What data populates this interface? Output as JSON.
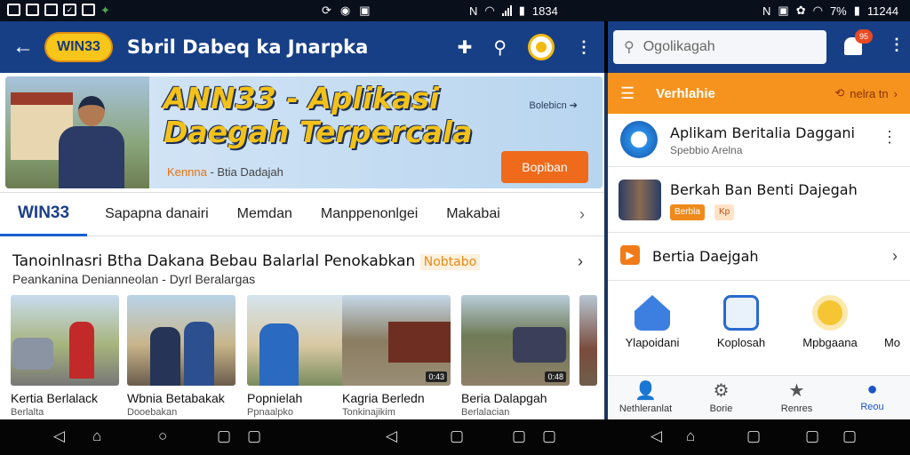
{
  "status_bar": {
    "left_icons": [
      "notification-icon",
      "image-icon",
      "gallery-icon",
      "check-icon",
      "cast-icon",
      "bolt-icon"
    ],
    "mid_icons": [
      "sync-icon",
      "shield-icon",
      "mail-icon"
    ],
    "time_1": "1834",
    "battery_text": "7%",
    "time_2": "11244"
  },
  "left_app": {
    "logo": "WIN33",
    "title": "Sbril Dabeq ka Jnarpka",
    "hero": {
      "title": "ANN33 - Aplikasi Daegah Terpercala",
      "sub_orange": "Kennna",
      "sub_rest": " - Btia Dadajah",
      "link": "Bolebicn",
      "button": "Bopiban"
    },
    "tabs": [
      "WIN33",
      "Sapapna danairi",
      "Memdan",
      "Manppenonlgei",
      "Makabai"
    ],
    "section": {
      "title": "Tanoinlnasri Btha Dakana Bebau Balarlal Penokabkan",
      "tag": "Nobtabo",
      "subtitle": "Peankanina Denianneolan - Dyrl Beralargas"
    },
    "cards": [
      {
        "t1": "Kertia Berlalack",
        "t2": "Berlalta",
        "duration": ""
      },
      {
        "t1": "Wbnia Betabakak",
        "t2": "Dooebakan",
        "duration": ""
      },
      {
        "t1": "Popnielah",
        "t2": "Ppnaalpko",
        "duration": ""
      },
      {
        "t1": "Kagria Berledn",
        "t2": "Tonkinajikim",
        "duration": "0:43"
      },
      {
        "t1": "Beria Dalapgah",
        "t2": "Berlalacian",
        "duration": "0:48"
      }
    ]
  },
  "right_app": {
    "search_placeholder": "Ogolikagah",
    "badge": "95",
    "bar_title": "Verhlahie",
    "bar_right": "nelra tn",
    "rows": [
      {
        "t1": "Aplikam Beritalia Daggani",
        "t2": "Spebbio Arelna"
      },
      {
        "t1": "Berkah Ban Benti Dajegah",
        "chip1": "Berbla",
        "chip2": "Kp"
      },
      {
        "t1": "Bertia Daejgah"
      }
    ],
    "shortcuts": [
      "Ylapoidani",
      "Koplosah",
      "Mpbgaana",
      "Mo"
    ],
    "bottom_nav": [
      "Nethleranlat",
      "Borie",
      "Renres",
      "Reou"
    ]
  },
  "colors": {
    "appbar_blue": "#173f86",
    "accent_orange": "#f5931e",
    "logo_yellow": "#f8c61b"
  }
}
